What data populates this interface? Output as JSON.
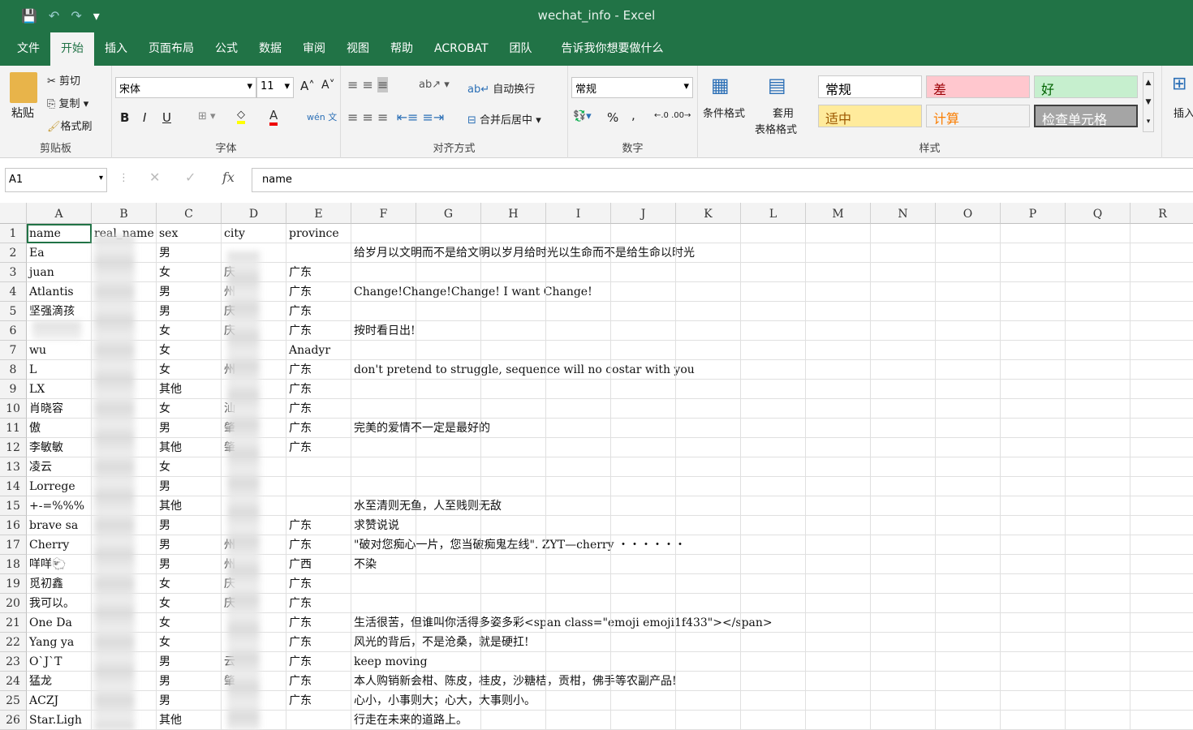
{
  "window": {
    "title": "wechat_info  -  Excel"
  },
  "tabs": [
    "文件",
    "开始",
    "插入",
    "页面布局",
    "公式",
    "数据",
    "审阅",
    "视图",
    "帮助",
    "ACROBAT",
    "团队",
    "告诉我你想要做什么"
  ],
  "active_tab": "开始",
  "ribbon": {
    "clipboard": {
      "paste": "粘贴",
      "cut": "剪切",
      "copy": "复制",
      "format_painter": "格式刷",
      "label": "剪贴板"
    },
    "font": {
      "name": "宋体",
      "size": "11",
      "bold": "B",
      "italic": "I",
      "underline": "U",
      "label": "字体",
      "phonetic": "wén 文"
    },
    "alignment": {
      "wrap": "自动换行",
      "merge": "合并后居中",
      "label": "对齐方式"
    },
    "number": {
      "format": "常规",
      "percent": "%",
      "comma": ",",
      "label": "数字"
    },
    "styles": {
      "conditional": "条件格式",
      "table_1": "套用",
      "table_2": "表格格式",
      "label": "样式",
      "cells": [
        {
          "text": "常规",
          "bg": "#ffffff",
          "fg": "#000000"
        },
        {
          "text": "差",
          "bg": "#ffc7ce",
          "fg": "#9c0006"
        },
        {
          "text": "好",
          "bg": "#c6efce",
          "fg": "#006100"
        },
        {
          "text": "适中",
          "bg": "#ffeb9c",
          "fg": "#9c5700"
        },
        {
          "text": "计算",
          "bg": "#f2f2f2",
          "fg": "#fa7d00"
        },
        {
          "text": "检查单元格",
          "bg": "#a5a5a5",
          "fg": "#ffffff"
        }
      ]
    },
    "insert": "插入"
  },
  "formula_bar": {
    "name_box": "A1",
    "fx": "fx",
    "value": "name"
  },
  "columns": [
    "A",
    "B",
    "C",
    "D",
    "E",
    "F",
    "G",
    "H",
    "I",
    "J",
    "K",
    "L",
    "M",
    "N",
    "O",
    "P",
    "Q",
    "R"
  ],
  "rows": [
    [
      "name",
      "real_name",
      "sex",
      "city",
      "province",
      ""
    ],
    [
      "Ea",
      "",
      "男",
      "",
      "",
      "给岁月以文明而不是给文明以岁月给时光以生命而不是给生命以时光"
    ],
    [
      "juan",
      "",
      "女",
      "庆",
      "广东",
      ""
    ],
    [
      "Atlantis",
      "",
      "男",
      "州",
      "广东",
      "Change!Change!Change! I want Change!"
    ],
    [
      "坚强滴孩",
      "",
      "男",
      "庆",
      "广东",
      ""
    ],
    [
      "",
      "",
      "女",
      "庆",
      "广东",
      "按时看日出!"
    ],
    [
      "wu",
      "",
      "女",
      "",
      "Anadyr",
      ""
    ],
    [
      "L",
      "",
      "女",
      "州",
      "广东",
      "don't pretend to struggle,  sequence will no costar with you"
    ],
    [
      "LX",
      "",
      "其他",
      "",
      "广东",
      ""
    ],
    [
      "肖晓容",
      "",
      "女",
      "汕",
      "广东",
      ""
    ],
    [
      "傲",
      "",
      "男",
      "肇",
      "广东",
      "完美的爱情不一定是最好的"
    ],
    [
      "李敏敏",
      "",
      "其他",
      "肇",
      "广东",
      ""
    ],
    [
      "凌云",
      "",
      "女",
      "",
      "",
      ""
    ],
    [
      "Lorrege",
      "",
      "男",
      "",
      "",
      ""
    ],
    [
      "+-=%%%",
      "",
      "其他",
      "",
      "",
      "水至清则无鱼，人至贱则无敌"
    ],
    [
      "brave sa",
      "",
      "男",
      "",
      "广东",
      "求赞说说"
    ],
    [
      "Cherry",
      "",
      "男",
      "州",
      "广东",
      "\"破对您痴心一片，您当破痴鬼左线\".   ZYT—cherry   ・・・・・・"
    ],
    [
      "咩咩🐑",
      "",
      "男",
      "州",
      "广西",
      "不染"
    ],
    [
      "觅初鑫",
      "",
      "女",
      "庆",
      "广东",
      ""
    ],
    [
      "我可以。",
      "",
      "女",
      "庆",
      "广东",
      ""
    ],
    [
      "One  Da",
      "",
      "女",
      "",
      "广东",
      "生活很苦，但谁叫你活得多姿多彩<span class=\"emoji emoji1f433\"></span>"
    ],
    [
      "Yang ya",
      "",
      "女",
      "",
      "广东",
      "风光的背后，不是沧桑，就是硬扛!"
    ],
    [
      "O`J`T",
      "",
      "男",
      "云",
      "广东",
      "keep  moving"
    ],
    [
      "猛龙",
      "",
      "男",
      "肇",
      "广东",
      "本人购销新会柑、陈皮，桂皮，沙糖桔，贡柑，佛手等农副产品!"
    ],
    [
      "ACZJ",
      "",
      "男",
      "",
      "广东",
      "心小，小事则大；心大，大事则小。"
    ],
    [
      "Star.Ligh",
      "",
      "其他",
      "",
      "",
      "行走在未来的道路上。"
    ]
  ]
}
